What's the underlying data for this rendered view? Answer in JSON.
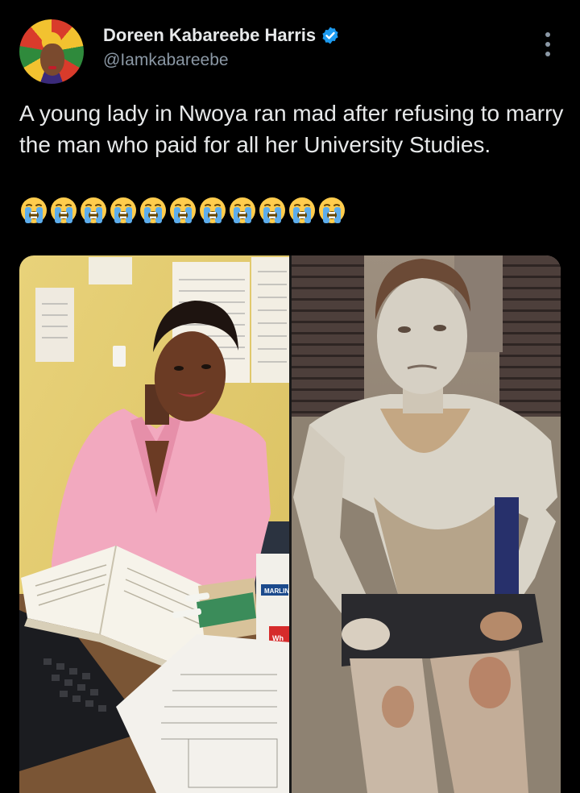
{
  "author": {
    "display_name": "Doreen Kabareebe Harris",
    "handle": "@Iamkabareebe",
    "verified": true
  },
  "tweet": {
    "text": "A young lady in Nwoya ran mad after refusing to marry the man who paid for all her University Studies.",
    "emoji_name": "loudly-crying-face",
    "emoji_count": 11
  },
  "media": {
    "left_photo_print": {
      "box_brand": "MARLIN",
      "box_partial": "Wh"
    }
  },
  "colors": {
    "background": "#000000",
    "text_primary": "#e7e9ea",
    "text_secondary": "#8b98a5",
    "verified_blue": "#1d9bf0"
  }
}
